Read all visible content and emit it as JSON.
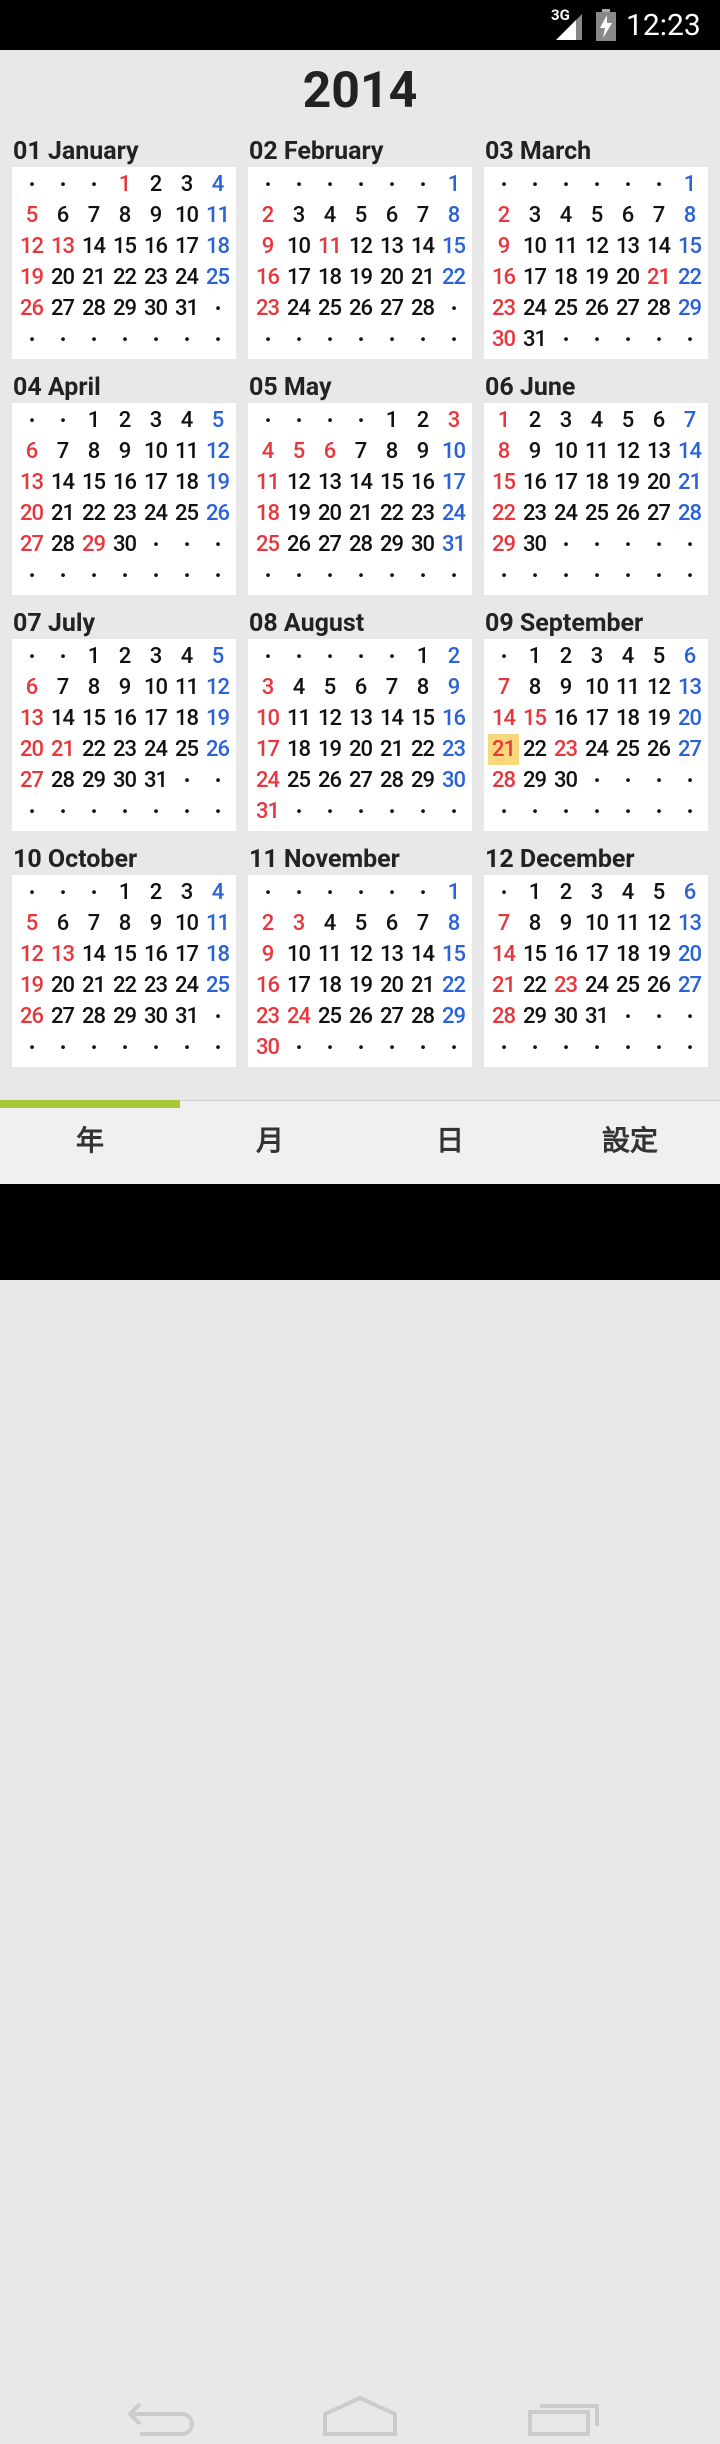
{
  "status": {
    "network": "3G",
    "time": "12:23"
  },
  "year": "2014",
  "today": "21",
  "colors": {
    "red": "#e8373c",
    "blue": "#2a62d8",
    "today": "#f9d77c",
    "tabIndicator": "#a6c832"
  },
  "tabs": [
    {
      "label": "年",
      "name": "tab-year"
    },
    {
      "label": "月",
      "name": "tab-month"
    },
    {
      "label": "日",
      "name": "tab-day"
    },
    {
      "label": "設定",
      "name": "tab-settings"
    }
  ],
  "months": [
    {
      "title": "01 January",
      "start": 3,
      "days": 31,
      "holidays": [
        1,
        13
      ],
      "today": null
    },
    {
      "title": "02 February",
      "start": 6,
      "days": 28,
      "holidays": [
        11
      ],
      "today": null
    },
    {
      "title": "03 March",
      "start": 6,
      "days": 31,
      "holidays": [
        21
      ],
      "today": null
    },
    {
      "title": "04 April",
      "start": 2,
      "days": 30,
      "holidays": [
        29
      ],
      "today": null
    },
    {
      "title": "05 May",
      "start": 4,
      "days": 31,
      "holidays": [
        3,
        5,
        6
      ],
      "today": null
    },
    {
      "title": "06 June",
      "start": 0,
      "days": 30,
      "holidays": [],
      "today": null
    },
    {
      "title": "07 July",
      "start": 2,
      "days": 31,
      "holidays": [
        21
      ],
      "today": null
    },
    {
      "title": "08 August",
      "start": 5,
      "days": 31,
      "holidays": [],
      "today": null
    },
    {
      "title": "09 September",
      "start": 1,
      "days": 30,
      "holidays": [
        15,
        23
      ],
      "today": 21
    },
    {
      "title": "10 October",
      "start": 3,
      "days": 31,
      "holidays": [
        13
      ],
      "today": null
    },
    {
      "title": "11 November",
      "start": 6,
      "days": 30,
      "holidays": [
        3,
        24
      ],
      "today": null
    },
    {
      "title": "12 December",
      "start": 1,
      "days": 31,
      "holidays": [
        23
      ],
      "today": null
    }
  ]
}
